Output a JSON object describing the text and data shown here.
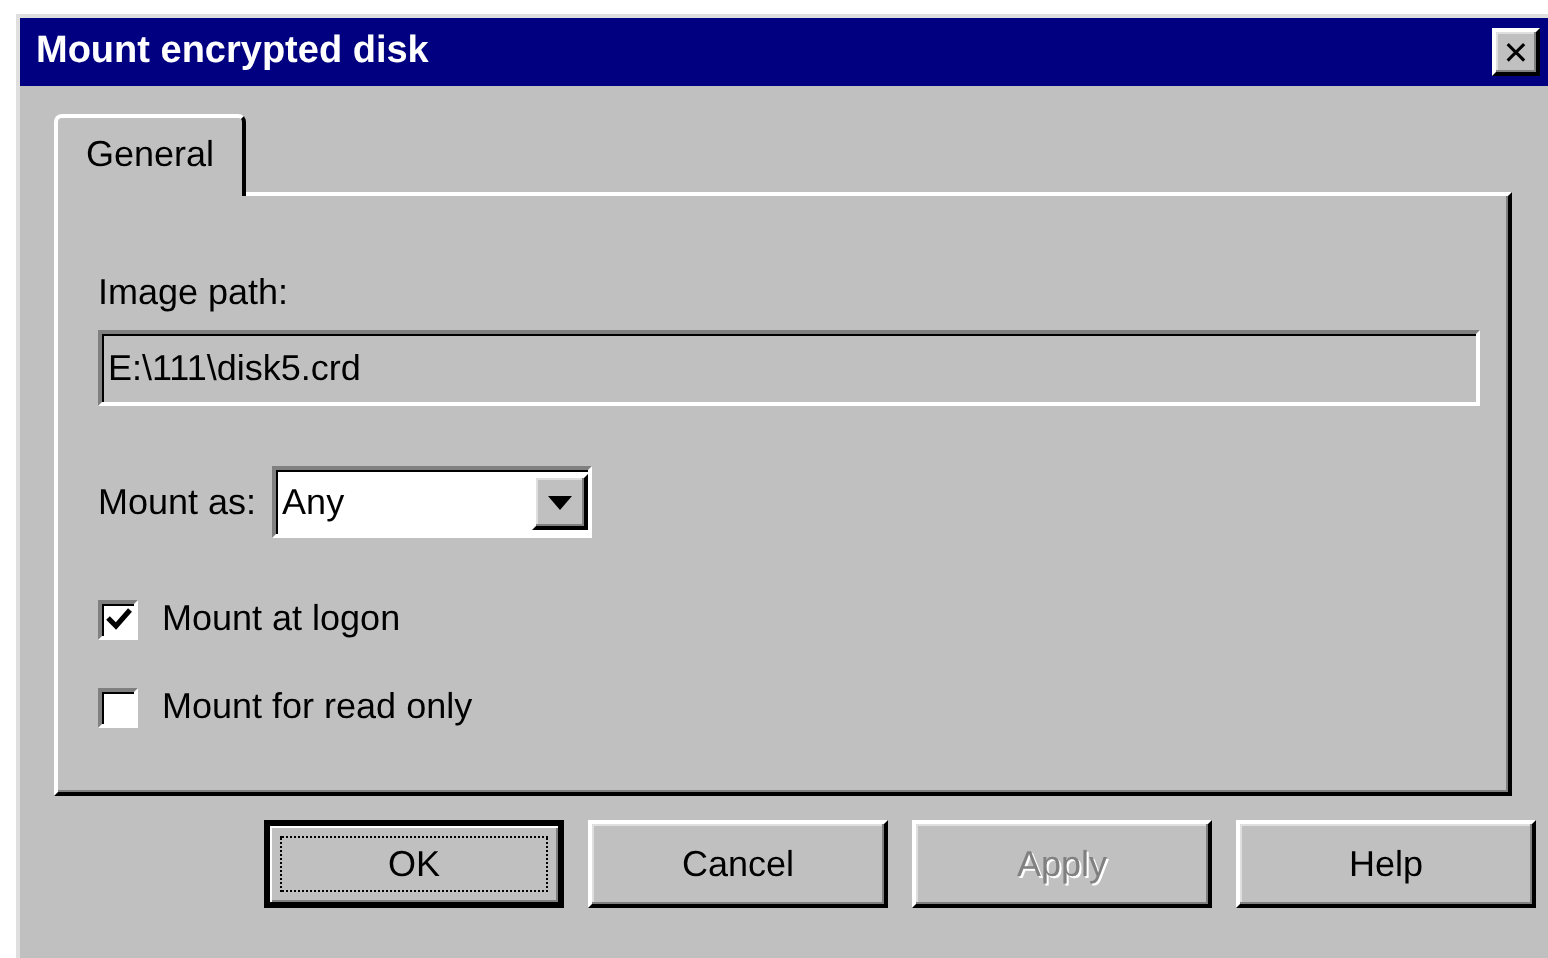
{
  "window": {
    "title": "Mount encrypted disk",
    "close_glyph": "✕"
  },
  "tabs": [
    {
      "label": "General",
      "selected": true
    }
  ],
  "image_path": {
    "label": "Image path:",
    "value": "E:\\111\\disk5.crd",
    "disabled": true
  },
  "mount_as": {
    "label": "Mount as:",
    "value": "Any"
  },
  "options": [
    {
      "label": "Mount at logon",
      "checked": true
    },
    {
      "label": "Mount for read only",
      "checked": false
    }
  ],
  "buttons": [
    {
      "label": "OK",
      "default": true,
      "disabled": false
    },
    {
      "label": "Cancel",
      "default": false,
      "disabled": false
    },
    {
      "label": "Apply",
      "default": false,
      "disabled": true
    },
    {
      "label": "Help",
      "default": false,
      "disabled": false
    }
  ]
}
